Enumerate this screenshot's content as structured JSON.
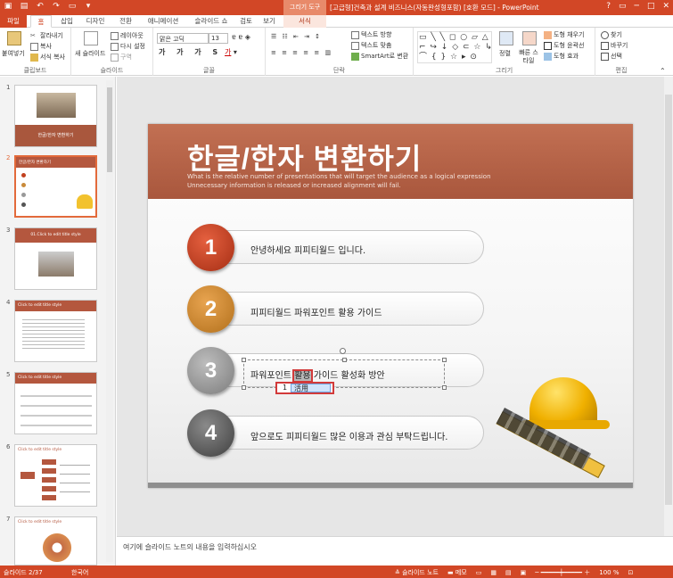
{
  "titlebar": {
    "title": "[고급형]건축과 설계 비즈니스(자동완성형포함) [호환 모드] - PowerPoint",
    "context_group": "그리기 도구",
    "qat": [
      "save",
      "undo",
      "redo",
      "start",
      "more"
    ],
    "window_buttons": [
      "?",
      "▭",
      "─",
      "□",
      "✕"
    ]
  },
  "tabs": {
    "file": "파일",
    "items": [
      "홈",
      "삽입",
      "디자인",
      "전환",
      "애니메이션",
      "슬라이드 쇼",
      "검토",
      "보기"
    ],
    "context": "서식"
  },
  "ribbon": {
    "clipboard": {
      "label": "클립보드",
      "paste": "붙여넣기",
      "cut": "잘라내기",
      "copy": "복사",
      "format": "서식 복사"
    },
    "slides": {
      "label": "슬라이드",
      "new": "새 슬라이드",
      "layout": "레이아웃",
      "reset": "다시 설정",
      "section": "구역"
    },
    "font": {
      "label": "글꼴",
      "name": "맑은 고딕",
      "size": "13"
    },
    "paragraph": {
      "label": "단락",
      "dir": "텍스트 방향",
      "align": "텍스트 맞춤",
      "smartart": "SmartArt로 변환"
    },
    "drawing": {
      "label": "그리기",
      "arrange": "정렬",
      "quick": "빠른 스타일",
      "fill": "도형 채우기",
      "outline": "도형 윤곽선",
      "effects": "도형 효과"
    },
    "editing": {
      "label": "편집",
      "find": "찾기",
      "replace": "바꾸기",
      "select": "선택"
    }
  },
  "thumbnails": [
    {
      "num": "1",
      "title": "한글/한자 변환하기"
    },
    {
      "num": "2",
      "title": "한글/한자 변환하기"
    },
    {
      "num": "3",
      "title": "01.Click to edit title style"
    },
    {
      "num": "4",
      "title": "Click to edit title style"
    },
    {
      "num": "5",
      "title": "Click to edit title style"
    },
    {
      "num": "6",
      "title": "Click to edit title style"
    },
    {
      "num": "7",
      "title": "Click to edit title style"
    }
  ],
  "slide": {
    "title": "한글/한자 변환하기",
    "subtitle1": "What is the relative number of presentations that will target the audience as a logical expression",
    "subtitle2": "Unnecessary information is released  or  increased alignment will fail.",
    "items": [
      {
        "num": "1",
        "text": "안녕하세요 피피티월드 입니다."
      },
      {
        "num": "2",
        "text": "피피티월드 파워포인트 활용 가이드"
      },
      {
        "num": "3",
        "text_before": "파워포인트 ",
        "highlight": "활용",
        "text_after": " 가이드 활성화 방안"
      },
      {
        "num": "4",
        "text": "앞으로도 피피티월드 많은 이용과 관심 부탁드립니다."
      }
    ],
    "ime_candidate": {
      "index": "1",
      "hanja": "活用"
    }
  },
  "notes": {
    "placeholder": "여기에 슬라이드 노트의 내용을 입력하십시오"
  },
  "status": {
    "slide": "슬라이드 2/37",
    "lang": "한국어",
    "notes": "슬라이드 노트",
    "comments": "메모",
    "zoom": "100 %"
  },
  "colors": {
    "accent": "#d24726",
    "header": "#b4573e"
  }
}
